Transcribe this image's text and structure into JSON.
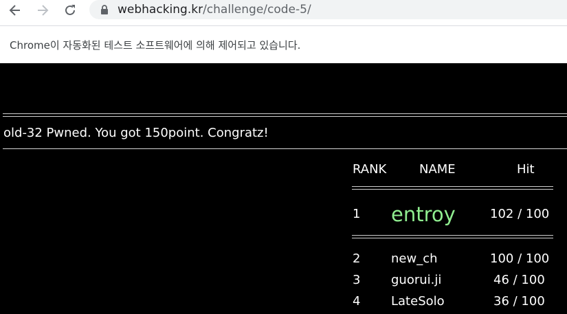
{
  "browser": {
    "url_host": "webhacking.kr",
    "url_path": "/challenge/code-5/",
    "automation_notice": "Chrome이 자동화된 테스트 소프트웨어에 의해 제어되고 있습니다."
  },
  "page": {
    "message": "old-32 Pwned. You got 150point. Congratz!",
    "table": {
      "headers": {
        "rank": "RANK",
        "name": "NAME",
        "hit": "Hit"
      },
      "top": {
        "rank": "1",
        "name": "entroy",
        "hit": "102 / 100"
      },
      "rows": [
        {
          "rank": "2",
          "name": "new_ch",
          "hit": "100 / 100"
        },
        {
          "rank": "3",
          "name": "guorui.ji",
          "hit": "46 / 100"
        },
        {
          "rank": "4",
          "name": "LateSolo",
          "hit": "36 / 100"
        }
      ]
    },
    "colors": {
      "top_name": "#90ee90",
      "background": "#000000",
      "text": "#ffffff"
    }
  }
}
